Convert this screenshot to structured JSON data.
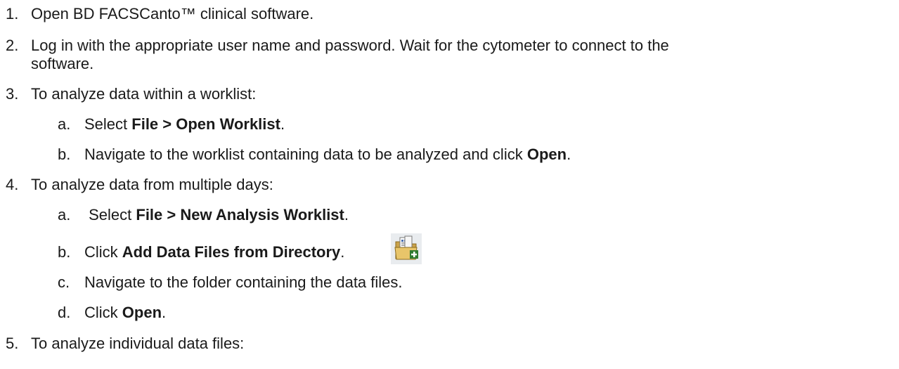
{
  "steps": [
    {
      "num": "1.",
      "text": "Open BD FACSCanto™ clinical software."
    },
    {
      "num": "2.",
      "text": "Log in with the appropriate user name and password. Wait for the cytometer to connect to the",
      "cont": "software."
    },
    {
      "num": "3.",
      "text": "To analyze data within a worklist:",
      "sub": [
        {
          "num": "a.",
          "pre": "Select ",
          "bold": "File > Open Worklist",
          "post": "."
        },
        {
          "num": "b.",
          "pre": "Navigate to the worklist containing data to be analyzed and click ",
          "bold": "Open",
          "post": "."
        }
      ]
    },
    {
      "num": "4.",
      "text": "To analyze data from multiple days:",
      "sub": [
        {
          "num": "a.",
          "pre": " Select ",
          "bold": "File > New Analysis Worklist",
          "post": "."
        },
        {
          "num": "b.",
          "pre": "Click ",
          "bold": "Add Data Files from Directory",
          "post": "."
        },
        {
          "num": "c.",
          "pre": "Navigate to the folder containing the data files.",
          "bold": "",
          "post": ""
        },
        {
          "num": "d.",
          "pre": "Click ",
          "bold": "Open",
          "post": "."
        }
      ]
    },
    {
      "num": "5.",
      "text": "To analyze individual data files:"
    }
  ],
  "icons": {
    "add_data_files": "add-data-files-from-directory-icon"
  }
}
